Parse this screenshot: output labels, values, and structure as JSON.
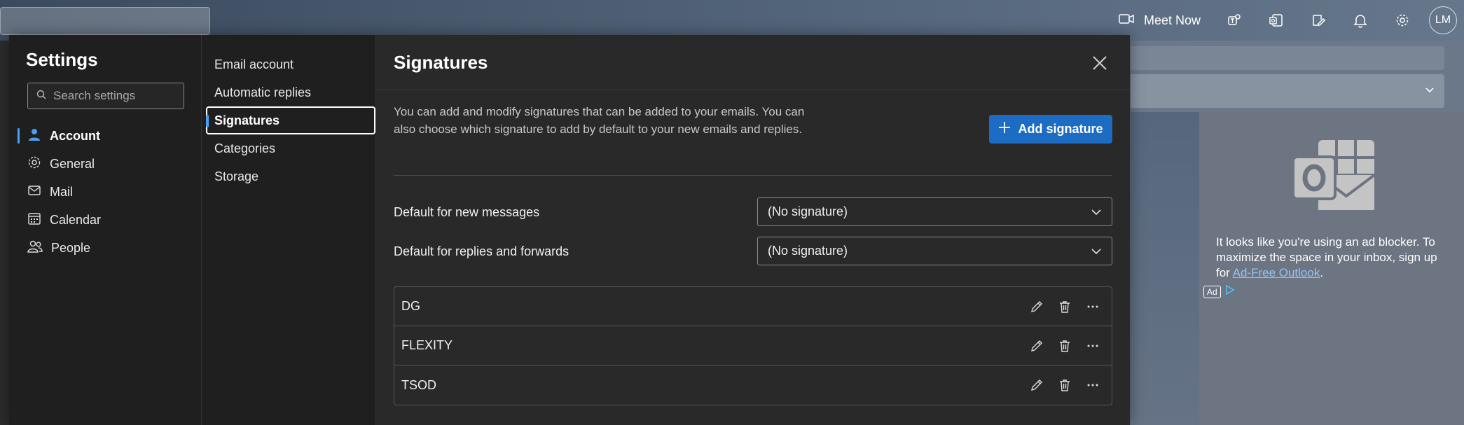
{
  "topbar": {
    "meet_now_label": "Meet Now",
    "avatar_initials": "LM",
    "icons": [
      "video-camera-icon",
      "teams-icon",
      "outlook-icon",
      "compose-note-icon",
      "bell-icon",
      "gear-icon"
    ]
  },
  "settings": {
    "title": "Settings",
    "search_placeholder": "Search settings",
    "categories": [
      {
        "label": "Account",
        "icon": "person-icon",
        "active": true
      },
      {
        "label": "General",
        "icon": "gear-icon"
      },
      {
        "label": "Mail",
        "icon": "mail-icon"
      },
      {
        "label": "Calendar",
        "icon": "calendar-icon"
      },
      {
        "label": "People",
        "icon": "people-icon"
      }
    ],
    "subnav": [
      {
        "label": "Email account"
      },
      {
        "label": "Automatic replies"
      },
      {
        "label": "Signatures",
        "active": true
      },
      {
        "label": "Categories"
      },
      {
        "label": "Storage"
      }
    ]
  },
  "signatures": {
    "title": "Signatures",
    "description": "You can add and modify signatures that can be added to your emails. You can also choose which signature to add by default to your new emails and replies.",
    "add_button_label": "Add signature",
    "default_new_label": "Default for new messages",
    "default_new_value": "(No signature)",
    "default_reply_label": "Default for replies and forwards",
    "default_reply_value": "(No signature)",
    "items": [
      {
        "name": "DG"
      },
      {
        "name": "FLEXITY"
      },
      {
        "name": "TSOD"
      }
    ]
  },
  "ad": {
    "text_before": "It looks like you're using an ad blocker. To maximize the space in your inbox, sign up for ",
    "link_text": "Ad-Free Outlook",
    "text_after": ".",
    "badge": "Ad"
  },
  "colors": {
    "accent": "#1c6cc4",
    "active_indicator": "#4aa0f0",
    "dialog_bg": "#292929",
    "nav_bg": "#1f1f1f"
  }
}
